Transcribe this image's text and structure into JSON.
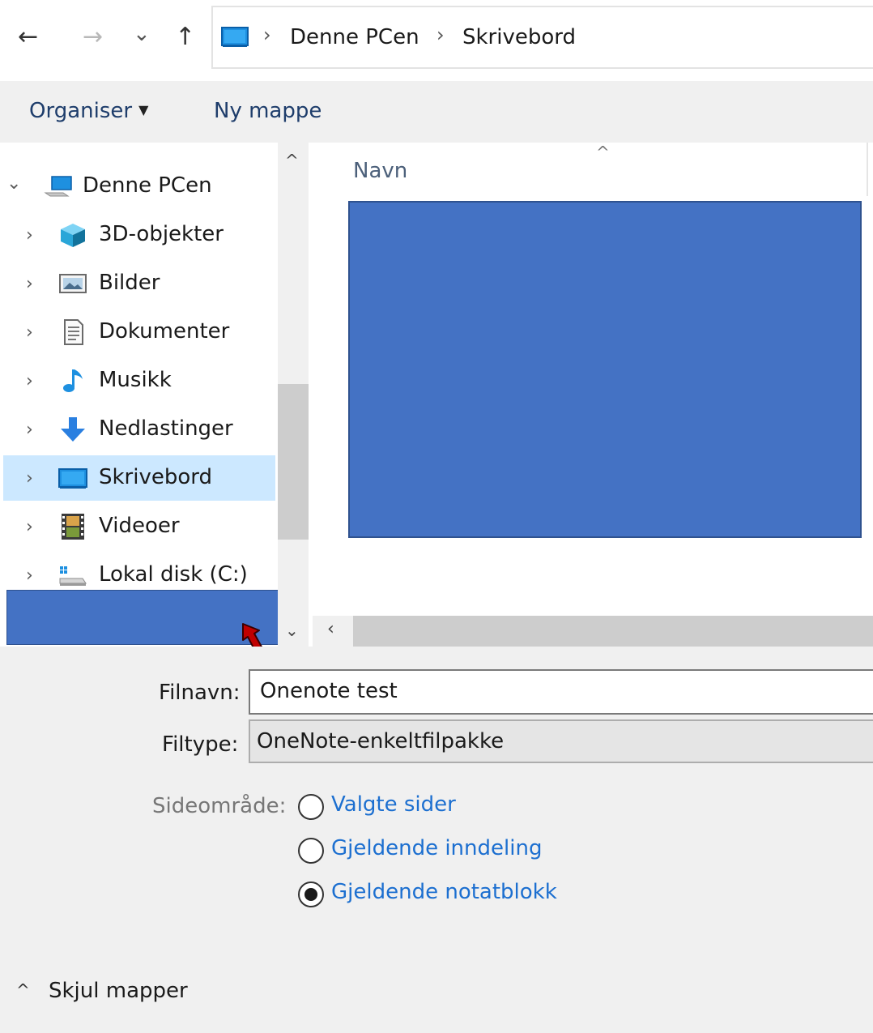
{
  "toolbar": {
    "back_icon": "←",
    "forward_icon": "→",
    "recent_icon": "⌄",
    "up_icon": "↑"
  },
  "breadcrumb": {
    "items": [
      "Denne PCen",
      "Skrivebord"
    ]
  },
  "commands": {
    "organize_label": "Organiser",
    "organize_caret": "▼",
    "new_folder_label": "Ny mappe"
  },
  "nav_tree": {
    "root": {
      "label": "Denne PCen",
      "icon": "computer-icon"
    },
    "items": [
      {
        "label": "3D-objekter",
        "icon": "cube-3d-icon"
      },
      {
        "label": "Bilder",
        "icon": "pictures-icon"
      },
      {
        "label": "Dokumenter",
        "icon": "document-icon"
      },
      {
        "label": "Musikk",
        "icon": "music-note-icon"
      },
      {
        "label": "Nedlastinger",
        "icon": "download-arrow-icon"
      },
      {
        "label": "Skrivebord",
        "icon": "desktop-icon",
        "selected": true
      },
      {
        "label": "Videoer",
        "icon": "film-icon"
      },
      {
        "label": "Lokal disk (C:)",
        "icon": "drive-icon"
      }
    ]
  },
  "file_list": {
    "column_name": "Navn"
  },
  "form": {
    "filename_label": "Filnavn:",
    "filename_value": "Onenote test",
    "filetype_label": "Filtype:",
    "filetype_value": "OneNote-enkeltfilpakke",
    "page_range_label": "Sideområde:",
    "radio_options": [
      {
        "label": "Valgte sider",
        "checked": false
      },
      {
        "label": "Gjeldende inndeling",
        "checked": false
      },
      {
        "label": "Gjeldende notatblokk",
        "checked": true
      }
    ]
  },
  "footer": {
    "hide_folders_label": "Skjul mapper"
  },
  "colors": {
    "redaction": "#4472c4",
    "selection": "#cce8ff",
    "link_blue": "#1c6fd0",
    "annotation_arrow": "#c00000"
  }
}
